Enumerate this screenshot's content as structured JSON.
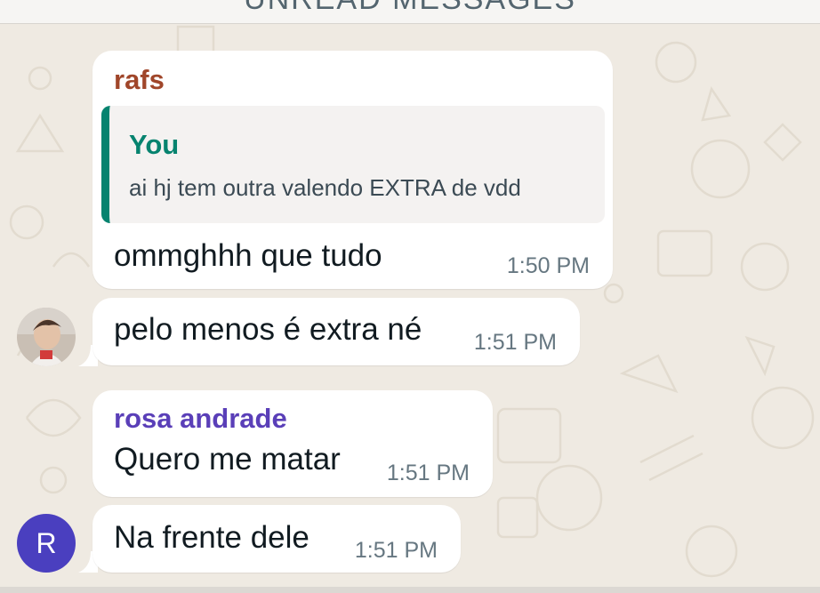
{
  "unread_banner": {
    "label": "UNREAD MESSAGES"
  },
  "messages": [
    {
      "sender": "rafs",
      "sender_color": "#a0462a",
      "quoted": {
        "author": "You",
        "text": "ai hj tem outra valendo EXTRA de vdd"
      },
      "text": "ommghhh que tudo",
      "time": "1:50 PM"
    },
    {
      "text": "pelo menos é extra né",
      "time": "1:51 PM",
      "avatar": "photo-avatar"
    },
    {
      "sender": "rosa andrade",
      "sender_color": "#5a3fb8",
      "text": "Quero me matar",
      "time": "1:51 PM"
    },
    {
      "text": "Na frente dele",
      "time": "1:51 PM",
      "avatar_initial": "R"
    }
  ],
  "colors": {
    "background": "#efeae2",
    "bubble": "#ffffff",
    "quote_accent": "#06836f",
    "avatar_r": "#4a3fbf"
  }
}
